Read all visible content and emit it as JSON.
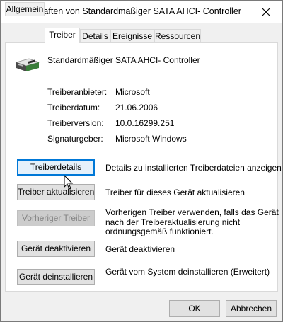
{
  "window": {
    "title": "Eigenschaften von Standardmäßiger SATA AHCI- Controller"
  },
  "tabs": [
    {
      "label": "Allgemein",
      "active": false
    },
    {
      "label": "Treiber",
      "active": true
    },
    {
      "label": "Details",
      "active": false
    },
    {
      "label": "Ereignisse",
      "active": false
    },
    {
      "label": "Ressourcen",
      "active": false
    }
  ],
  "device": {
    "name": "Standardmäßiger SATA AHCI- Controller",
    "icon": "storage-controller-icon"
  },
  "info": {
    "provider_label": "Treiberanbieter:",
    "provider_value": "Microsoft",
    "date_label": "Treiberdatum:",
    "date_value": "21.06.2006",
    "version_label": "Treiberversion:",
    "version_value": "10.0.16299.251",
    "signer_label": "Signaturgeber:",
    "signer_value": "Microsoft Windows"
  },
  "actions": {
    "details_button": "Treiberdetails",
    "details_desc": "Details zu installierten Treiberdateien anzeigen",
    "update_button": "Treiber aktualisieren",
    "update_desc": "Treiber für dieses Gerät aktualisieren",
    "rollback_button": "Vorheriger Treiber",
    "rollback_desc_1": "Vorherigen Treiber verwenden, falls das Gerät",
    "rollback_desc_2": "nach der Treiberaktualisierung nicht",
    "rollback_desc_3": "ordnungsgemäß funktioniert.",
    "disable_button": "Gerät deaktivieren",
    "disable_desc": "Gerät deaktivieren",
    "uninstall_button": "Gerät deinstallieren",
    "uninstall_desc": "Gerät vom System deinstallieren (Erweitert)"
  },
  "footer": {
    "ok": "OK",
    "cancel": "Abbrechen"
  },
  "colors": {
    "focus_border": "#0078d7",
    "button_bg": "#e1e1e1",
    "disabled_text": "#838383"
  }
}
